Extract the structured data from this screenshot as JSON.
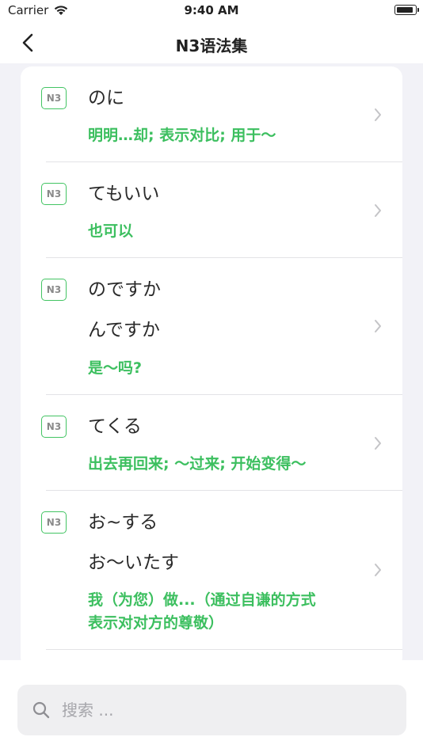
{
  "status_bar": {
    "carrier": "Carrier",
    "time": "9:40 AM"
  },
  "nav": {
    "title": "N3语法集"
  },
  "items": [
    {
      "badge": "N3",
      "jp": [
        "のに"
      ],
      "cn": [
        "明明…却; 表示对比; 用于～"
      ]
    },
    {
      "badge": "N3",
      "jp": [
        "てもいい"
      ],
      "cn": [
        "也可以"
      ]
    },
    {
      "badge": "N3",
      "jp": [
        "のですか",
        "んですか"
      ],
      "cn": [
        "是～吗?"
      ]
    },
    {
      "badge": "N3",
      "jp": [
        "てくる"
      ],
      "cn": [
        "出去再回来; ～过来; 开始变得～"
      ]
    },
    {
      "badge": "N3",
      "jp": [
        "お~する",
        "お～いたす"
      ],
      "cn": [
        "我（为您）做...（通过自谦的方式",
        "表示对对方的尊敬）"
      ]
    }
  ],
  "search": {
    "placeholder": "搜索 ..."
  }
}
